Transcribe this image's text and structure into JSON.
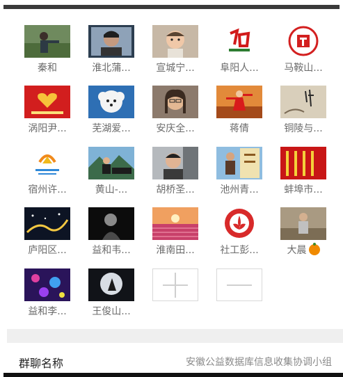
{
  "members": [
    {
      "name": "秦和",
      "icon": "avatar-mountain-person"
    },
    {
      "name": "淮北蒲...",
      "icon": "avatar-man-photo"
    },
    {
      "name": "宣城宁...",
      "icon": "avatar-baby"
    },
    {
      "name": "阜阳人...",
      "icon": "avatar-calligraphy-logo"
    },
    {
      "name": "马鞍山...",
      "icon": "avatar-red-seal"
    },
    {
      "name": "涡阳尹...",
      "icon": "avatar-red-heart-logo"
    },
    {
      "name": "芜湖爱...",
      "icon": "avatar-white-dog"
    },
    {
      "name": "安庆全...",
      "icon": "avatar-woman-glasses"
    },
    {
      "name": "蒋倩",
      "icon": "avatar-woman-dancing"
    },
    {
      "name": "铜陵与...",
      "icon": "avatar-ink-painting"
    },
    {
      "name": "宿州许...",
      "icon": "avatar-sunshine-logo"
    },
    {
      "name": "黄山-...",
      "icon": "avatar-man-mountains"
    },
    {
      "name": "胡桥圣...",
      "icon": "avatar-man-car"
    },
    {
      "name": "池州青...",
      "icon": "avatar-man-poster"
    },
    {
      "name": "蚌埠市...",
      "icon": "avatar-red-banner"
    },
    {
      "name": "庐阳区...",
      "icon": "avatar-night-city"
    },
    {
      "name": "益和韦...",
      "icon": "avatar-dark-portrait"
    },
    {
      "name": "淮南田...",
      "icon": "avatar-sunset-field"
    },
    {
      "name": "社工彭...",
      "icon": "avatar-lotus-seal"
    },
    {
      "name": "大晨",
      "icon": "avatar-vintage-photo",
      "emoji": "tangerine-icon"
    },
    {
      "name": "益和李...",
      "icon": "avatar-purple-lights"
    },
    {
      "name": "王俊山...",
      "icon": "avatar-moon-silhouette"
    }
  ],
  "add_member_icon": "plus-icon",
  "remove_member_icon": "minus-icon",
  "group_name": {
    "label": "群聊名称",
    "value": "安徽公益数据库信息收集协调小组"
  }
}
